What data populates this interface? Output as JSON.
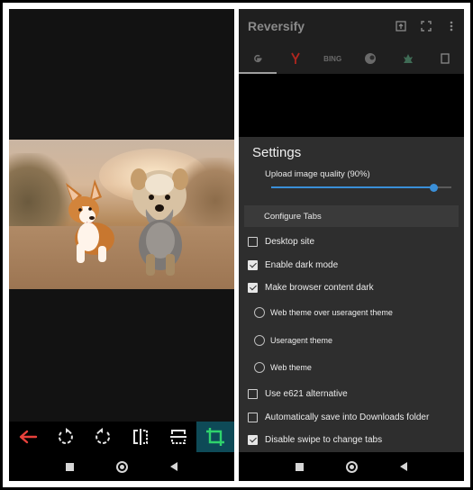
{
  "left_screen": {
    "toolbar": {
      "icons": [
        "back-arrow-icon",
        "rotate-left-icon",
        "rotate-right-icon",
        "flip-horizontal-icon",
        "flip-vertical-icon",
        "crop-icon"
      ],
      "colors": {
        "back": "#e8413b",
        "active_bg": "#0e4a57",
        "active_icon": "#2fd36c"
      }
    },
    "navbar": [
      "recents-square",
      "home-circle",
      "back-triangle"
    ]
  },
  "right_screen": {
    "app_title": "Reversify",
    "actions": [
      "open-tab-icon",
      "fullscreen-icon",
      "more-vert-icon"
    ],
    "tabs": [
      {
        "label": "",
        "icon": "google-icon",
        "selected": true
      },
      {
        "label": "",
        "icon": "yandex-icon"
      },
      {
        "label": "BING",
        "icon": "bing-text"
      },
      {
        "label": "",
        "icon": "tineye-icon"
      },
      {
        "label": "",
        "icon": "saucenao-icon"
      },
      {
        "label": "",
        "icon": "more-tab-icon"
      }
    ],
    "settings": {
      "title": "Settings",
      "upload_quality_label": "Upload image quality (90%)",
      "upload_quality_value": 0.9,
      "configure_tabs": "Configure Tabs",
      "options": [
        {
          "label": "Desktop site",
          "type": "checkbox",
          "checked": false
        },
        {
          "label": "Enable dark mode",
          "type": "checkbox",
          "checked": true
        },
        {
          "label": "Make browser content dark",
          "type": "checkbox",
          "checked": true
        },
        {
          "label": "Web theme over useragent theme",
          "type": "radio",
          "checked": false
        },
        {
          "label": "Useragent theme",
          "type": "radio",
          "checked": false
        },
        {
          "label": "Web theme",
          "type": "radio",
          "checked": false
        },
        {
          "label": "Use e621 alternative",
          "type": "checkbox",
          "checked": false
        },
        {
          "label": "Automatically save into Downloads folder",
          "type": "checkbox",
          "checked": false
        },
        {
          "label": "Disable swipe to change tabs",
          "type": "checkbox",
          "checked": true
        }
      ]
    }
  }
}
